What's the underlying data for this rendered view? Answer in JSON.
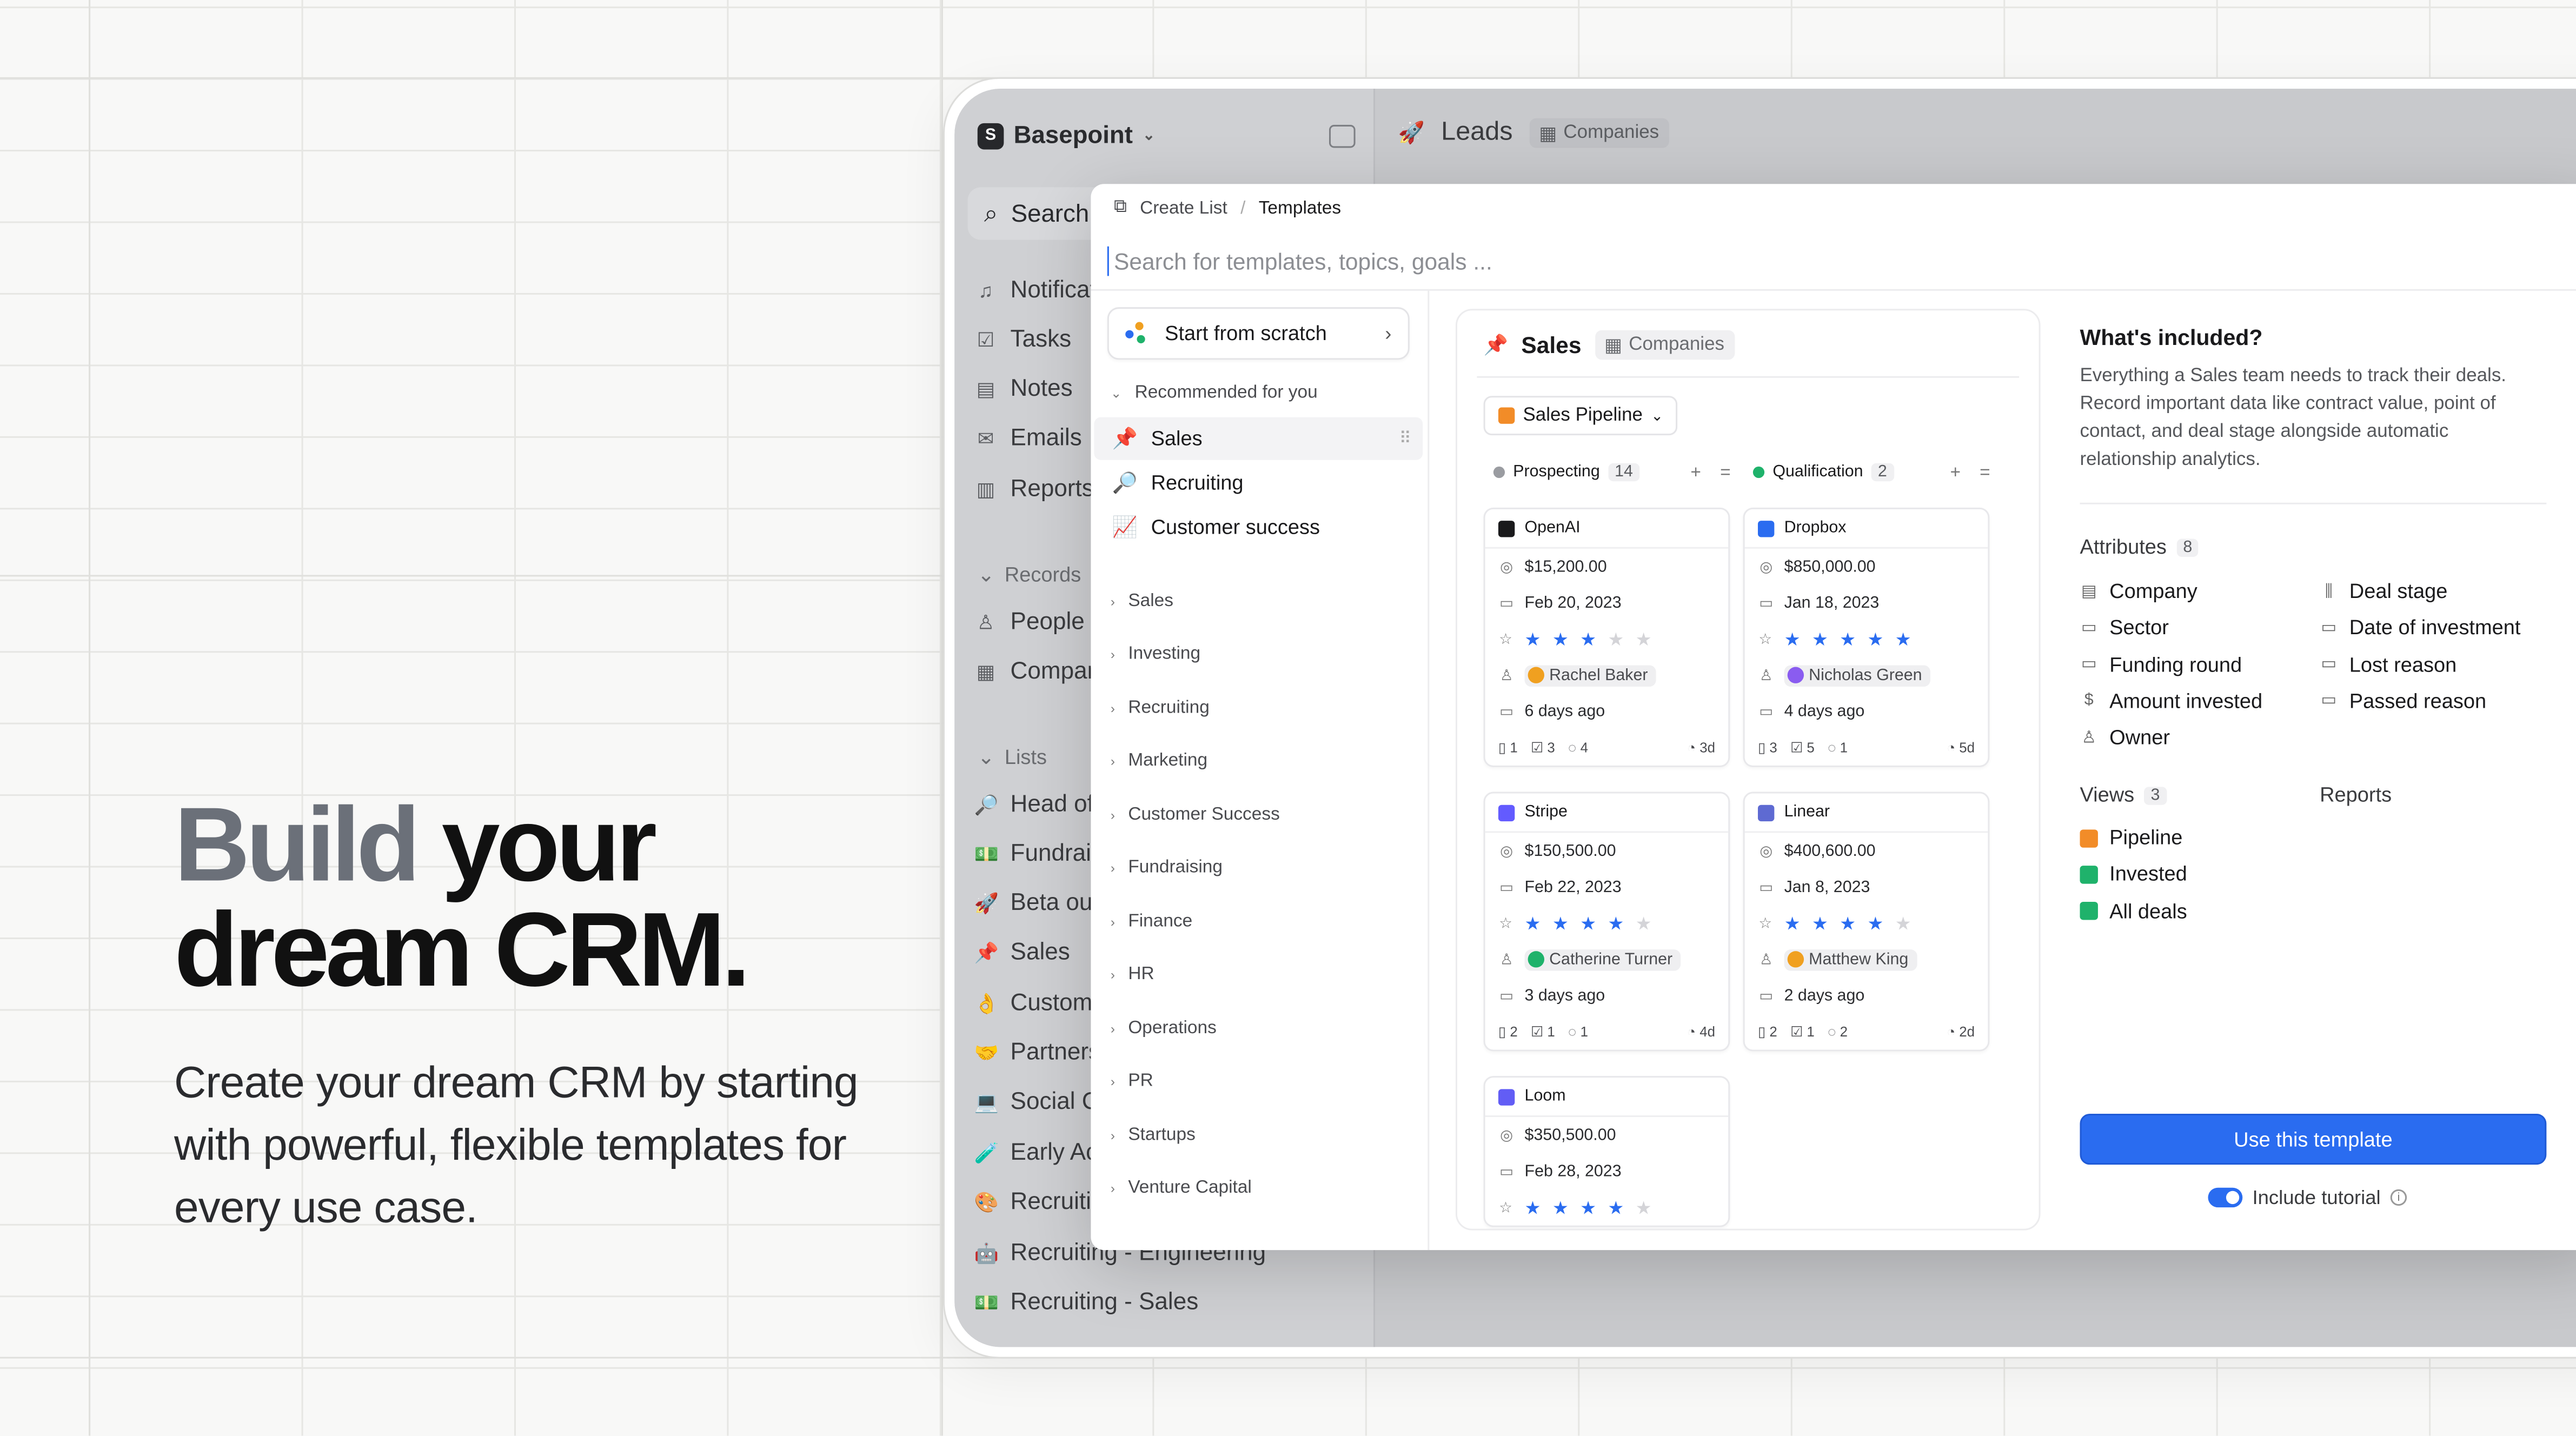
{
  "hero": {
    "title_muted": "Build",
    "title_rest": " your dream CRM.",
    "subtitle": "Create your dream CRM by starting with powerful, flexible templates for every use case."
  },
  "app": {
    "workspace": "Basepoint",
    "search_label": "Search",
    "nav": [
      "Notifications",
      "Tasks",
      "Notes",
      "Emails",
      "Reports"
    ],
    "records_label": "Records",
    "records": [
      "People",
      "Companies"
    ],
    "lists_label": "Lists",
    "lists": [
      "Head of X",
      "Fundraising",
      "Beta outreach",
      "Sales",
      "Customer success",
      "Partnerships",
      "Social Channels",
      "Early Access",
      "Recruiting",
      "Recruiting - Engineering",
      "Recruiting - Sales"
    ],
    "topbar_title": "Leads",
    "topbar_chip": "Companies"
  },
  "modal": {
    "breadcrumb_root": "Create List",
    "breadcrumb_current": "Templates",
    "search_placeholder": "Search for templates, topics, goals ...",
    "scratch_label": "Start from scratch",
    "recommended_label": "Recommended for you",
    "recommended": [
      {
        "icon": "📌",
        "label": "Sales"
      },
      {
        "icon": "🔎",
        "label": "Recruiting"
      },
      {
        "icon": "📈",
        "label": "Customer success"
      }
    ],
    "categories": [
      "Sales",
      "Investing",
      "Recruiting",
      "Marketing",
      "Customer Success",
      "Fundraising",
      "Finance",
      "HR",
      "Operations",
      "PR",
      "Startups",
      "Venture Capital"
    ]
  },
  "preview": {
    "title": "Sales",
    "chip": "Companies",
    "pipeline_label": "Sales Pipeline",
    "columns": [
      {
        "name": "Prospecting",
        "count": "14",
        "color": "#9a9ca1"
      },
      {
        "name": "Qualification",
        "count": "2",
        "color": "#1fb26b"
      }
    ],
    "cards": [
      {
        "company": "OpenAI",
        "logo_color": "#1a1a1c",
        "amount": "$15,200.00",
        "date": "Feb 20, 2023",
        "rating": 3,
        "owner": "Rachel Baker",
        "owner_color": "#f0a020",
        "ago": "6 days ago",
        "f1": "1",
        "f2": "3",
        "f3": "4",
        "age": "3d"
      },
      {
        "company": "Dropbox",
        "logo_color": "#2a6cf0",
        "amount": "$850,000.00",
        "date": "Jan 18, 2023",
        "rating": 5,
        "owner": "Nicholas Green",
        "owner_color": "#8a5cf0",
        "ago": "4 days ago",
        "f1": "3",
        "f2": "5",
        "f3": "1",
        "age": "5d"
      },
      {
        "company": "Stripe",
        "logo_color": "#635bff",
        "amount": "$150,500.00",
        "date": "Feb 22, 2023",
        "rating": 4,
        "owner": "Catherine Turner",
        "owner_color": "#1fb26b",
        "ago": "3 days ago",
        "f1": "2",
        "f2": "1",
        "f3": "1",
        "age": "4d"
      },
      {
        "company": "Linear",
        "logo_color": "#5e6ad2",
        "amount": "$400,600.00",
        "date": "Jan 8, 2023",
        "rating": 4,
        "owner": "Matthew King",
        "owner_color": "#f0a020",
        "ago": "2 days ago",
        "f1": "2",
        "f2": "1",
        "f3": "2",
        "age": "2d"
      },
      {
        "company": "Loom",
        "logo_color": "#625df5",
        "amount": "$350,500.00",
        "date": "Feb 28, 2023",
        "rating": 4
      }
    ]
  },
  "details": {
    "title": "What's included?",
    "description": "Everything a Sales team needs to track their deals. Record important data like contract value, point of contact, and deal stage alongside automatic relationship analytics.",
    "attributes_label": "Attributes",
    "attributes_count": "8",
    "attributes": [
      {
        "label": "Company",
        "icon": "▤"
      },
      {
        "label": "Deal stage",
        "icon": "⫼"
      },
      {
        "label": "Sector",
        "icon": "▭"
      },
      {
        "label": "Date of investment",
        "icon": "▭"
      },
      {
        "label": "Funding round",
        "icon": "▭"
      },
      {
        "label": "Lost reason",
        "icon": "▭"
      },
      {
        "label": "Amount invested",
        "icon": "$"
      },
      {
        "label": "Passed reason",
        "icon": "▭"
      },
      {
        "label": "Owner",
        "icon": "♙"
      }
    ],
    "views_label": "Views",
    "views_count": "3",
    "views": [
      {
        "label": "Pipeline",
        "color": "#f28c28"
      },
      {
        "label": "Invested",
        "color": "#1fb26b"
      },
      {
        "label": "All deals",
        "color": "#1fb26b"
      }
    ],
    "reports_label": "Reports",
    "use_button": "Use this template",
    "tutorial_label": "Include tutorial"
  }
}
